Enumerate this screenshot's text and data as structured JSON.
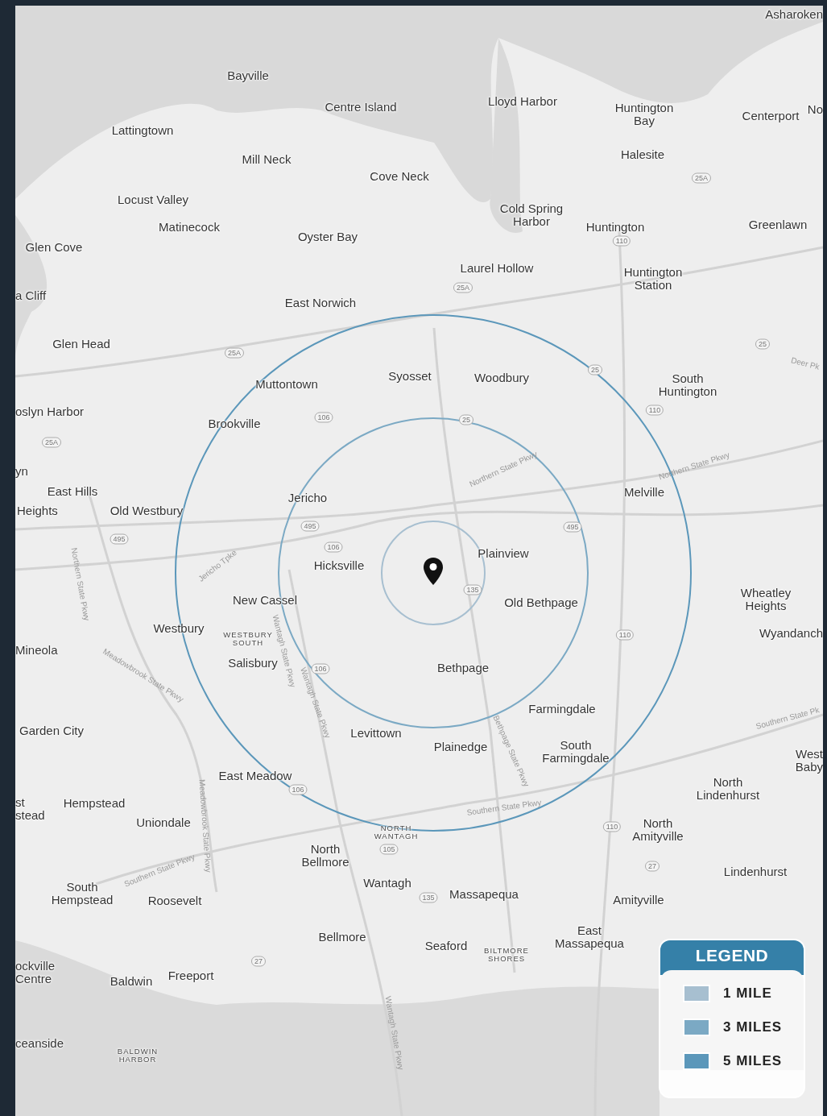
{
  "map": {
    "places": [
      {
        "name": "Asharoken",
        "kind": "town"
      },
      {
        "name": "Bayville",
        "kind": "town"
      },
      {
        "name": "Centre Island",
        "kind": "town"
      },
      {
        "name": "Lloyd Harbor",
        "kind": "town"
      },
      {
        "name": "Huntington\nBay",
        "kind": "town"
      },
      {
        "name": "Centerport",
        "kind": "town"
      },
      {
        "name": "No",
        "kind": "town"
      },
      {
        "name": "Lattingtown",
        "kind": "town"
      },
      {
        "name": "Mill Neck",
        "kind": "town"
      },
      {
        "name": "Halesite",
        "kind": "town"
      },
      {
        "name": "Cove Neck",
        "kind": "town"
      },
      {
        "name": "Locust Valley",
        "kind": "town"
      },
      {
        "name": "Matinecock",
        "kind": "town"
      },
      {
        "name": "Oyster Bay",
        "kind": "town"
      },
      {
        "name": "Cold Spring\nHarbor",
        "kind": "town"
      },
      {
        "name": "Huntington",
        "kind": "town"
      },
      {
        "name": "Greenlawn",
        "kind": "town"
      },
      {
        "name": "Glen Cove",
        "kind": "town"
      },
      {
        "name": "Laurel Hollow",
        "kind": "town"
      },
      {
        "name": "Huntington\nStation",
        "kind": "town"
      },
      {
        "name": "a Cliff",
        "kind": "town"
      },
      {
        "name": "East Norwich",
        "kind": "town"
      },
      {
        "name": "Glen Head",
        "kind": "town"
      },
      {
        "name": "Syosset",
        "kind": "town"
      },
      {
        "name": "Woodbury",
        "kind": "town"
      },
      {
        "name": "Muttontown",
        "kind": "town"
      },
      {
        "name": "South\nHuntington",
        "kind": "town"
      },
      {
        "name": "oslyn Harbor",
        "kind": "town"
      },
      {
        "name": "Brookville",
        "kind": "town"
      },
      {
        "name": "yn",
        "kind": "town"
      },
      {
        "name": "East Hills",
        "kind": "town"
      },
      {
        "name": "Heights",
        "kind": "town"
      },
      {
        "name": "Old Westbury",
        "kind": "town"
      },
      {
        "name": "Jericho",
        "kind": "town"
      },
      {
        "name": "Melville",
        "kind": "town"
      },
      {
        "name": "Plainview",
        "kind": "town"
      },
      {
        "name": "Hicksville",
        "kind": "town"
      },
      {
        "name": "New Cassel",
        "kind": "town"
      },
      {
        "name": "Old Bethpage",
        "kind": "town"
      },
      {
        "name": "Wheatley\nHeights",
        "kind": "town"
      },
      {
        "name": "Westbury",
        "kind": "town"
      },
      {
        "name": "WESTBURY\nSOUTH",
        "kind": "district"
      },
      {
        "name": "Wyandanch",
        "kind": "town"
      },
      {
        "name": "Mineola",
        "kind": "town"
      },
      {
        "name": "Salisbury",
        "kind": "town"
      },
      {
        "name": "Bethpage",
        "kind": "town"
      },
      {
        "name": "Farmingdale",
        "kind": "town"
      },
      {
        "name": "Garden City",
        "kind": "town"
      },
      {
        "name": "Levittown",
        "kind": "town"
      },
      {
        "name": "Plainedge",
        "kind": "town"
      },
      {
        "name": "South\nFarmingdale",
        "kind": "town"
      },
      {
        "name": "West Baby",
        "kind": "town"
      },
      {
        "name": "East Meadow",
        "kind": "town"
      },
      {
        "name": "North\nLindenhurst",
        "kind": "town"
      },
      {
        "name": "st\nstead",
        "kind": "town"
      },
      {
        "name": "Hempstead",
        "kind": "town"
      },
      {
        "name": "Uniondale",
        "kind": "town"
      },
      {
        "name": "NORTH\nWANTAGH",
        "kind": "district"
      },
      {
        "name": "North\nAmityville",
        "kind": "town"
      },
      {
        "name": "North\nBellmore",
        "kind": "town"
      },
      {
        "name": "South\nHempstead",
        "kind": "town"
      },
      {
        "name": "Roosevelt",
        "kind": "town"
      },
      {
        "name": "Wantagh",
        "kind": "town"
      },
      {
        "name": "Massapequa",
        "kind": "town"
      },
      {
        "name": "Amityville",
        "kind": "town"
      },
      {
        "name": "Lindenhurst",
        "kind": "town"
      },
      {
        "name": "Bellmore",
        "kind": "town"
      },
      {
        "name": "Seaford",
        "kind": "town"
      },
      {
        "name": "BILTMORE\nSHORES",
        "kind": "district"
      },
      {
        "name": "East\nMassapequa",
        "kind": "town"
      },
      {
        "name": "ockville\nCentre",
        "kind": "town"
      },
      {
        "name": "Baldwin",
        "kind": "town"
      },
      {
        "name": "Freeport",
        "kind": "town"
      },
      {
        "name": "ceanside",
        "kind": "town"
      },
      {
        "name": "BALDWIN\nHARBOR",
        "kind": "district"
      }
    ],
    "roads": [
      "Northern State Pkwy",
      "Northern State Pkwy",
      "Jericho Tpke",
      "Northern State Pkwy",
      "Meadowbrook State Pkwy",
      "Wantagh State Pkwy",
      "Wantagh State Pkwy",
      "Bethpage State Pkwy",
      "Southern State Pkwy",
      "Southern State Pkwy",
      "Southern State Pk",
      "Deer Pk",
      "Meadowbrook State Pkwy",
      "Wantagh State Pkwy"
    ],
    "shields": [
      "25A",
      "25A",
      "25A",
      "25A",
      "110",
      "25",
      "25",
      "25",
      "110",
      "106",
      "495",
      "495",
      "495",
      "106",
      "135",
      "110",
      "106",
      "106",
      "105",
      "110",
      "27",
      "135",
      "27"
    ]
  },
  "legend": {
    "title": "LEGEND",
    "items": [
      {
        "label": "1 MILE",
        "color": "#a7bfd0"
      },
      {
        "label": "3 MILES",
        "color": "#7ba9c4"
      },
      {
        "label": "5 MILES",
        "color": "#5b97ba"
      }
    ]
  }
}
